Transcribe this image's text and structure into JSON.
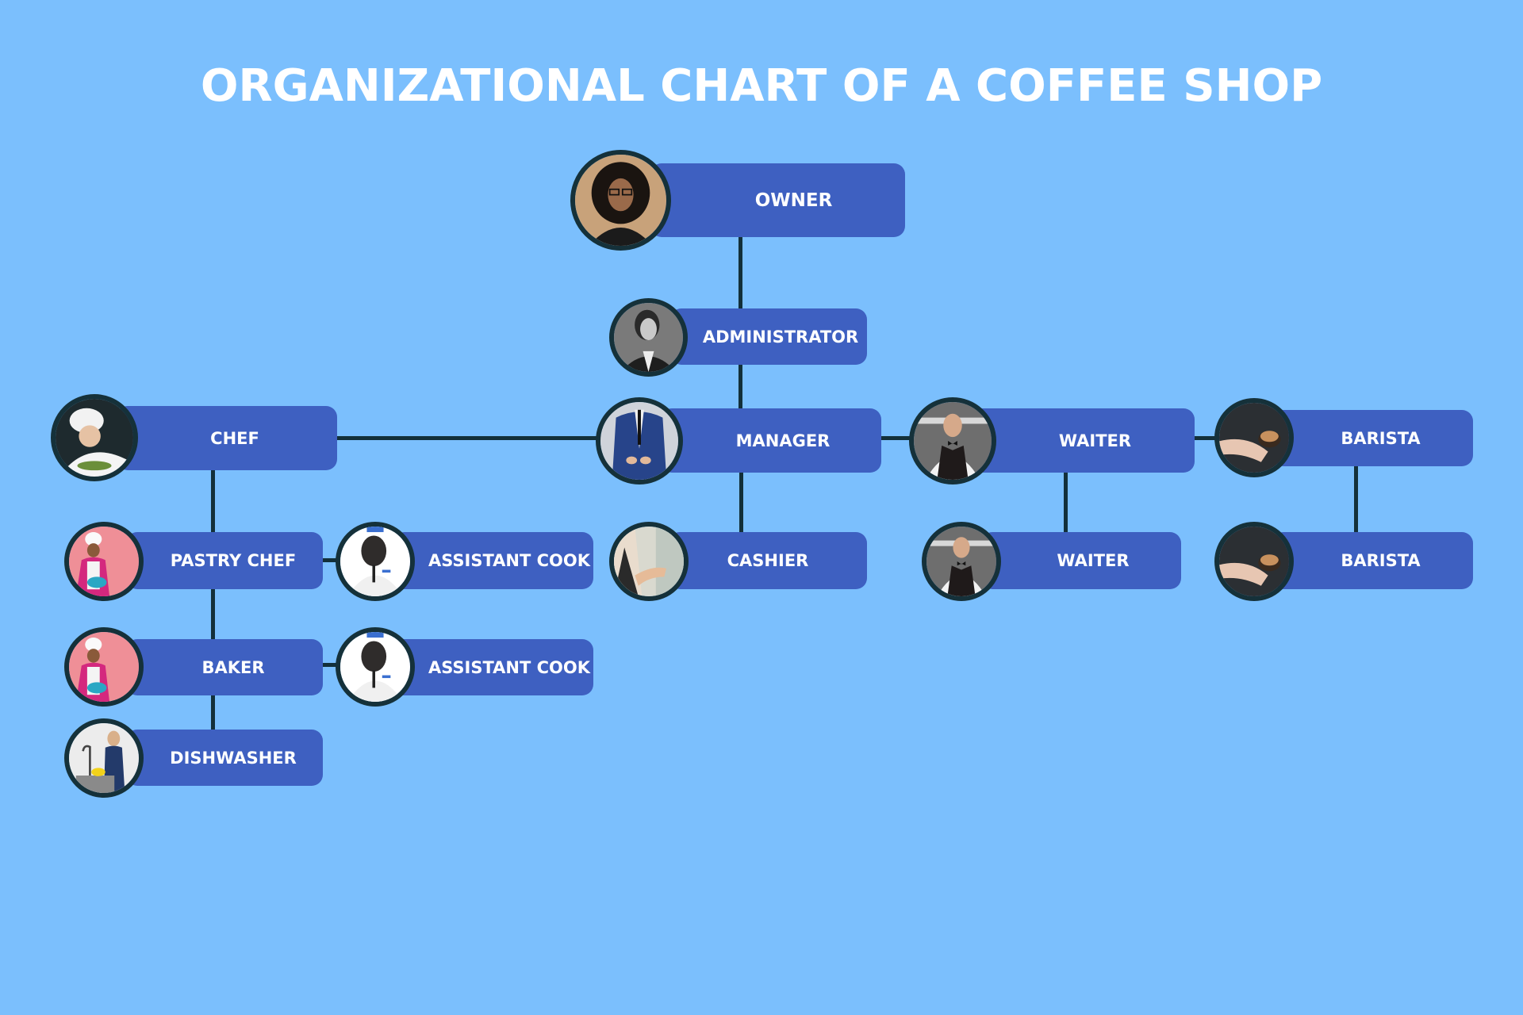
{
  "title": "ORGANIZATIONAL CHART OF A COFFEE SHOP",
  "colors": {
    "background": "#7bbffd",
    "box": "#3e60c1",
    "connector": "#13303a",
    "text": "#ffffff"
  },
  "nodes": {
    "owner": {
      "label": "OWNER",
      "photo": "woman-with-glasses-photo"
    },
    "administrator": {
      "label": "ADMINISTRATOR",
      "photo": "woman-in-suit-photo"
    },
    "manager": {
      "label": "MANAGER",
      "photo": "man-in-blue-suit-photo"
    },
    "chef": {
      "label": "CHEF",
      "photo": "chef-plating-photo"
    },
    "pastry_chef": {
      "label": "PASTRY CHEF",
      "photo": "pastry-chef-photo"
    },
    "assistant_cook_1": {
      "label": "ASSISTANT COOK",
      "photo": "cook-with-pan-photo"
    },
    "baker": {
      "label": "BAKER",
      "photo": "baker-photo"
    },
    "assistant_cook_2": {
      "label": "ASSISTANT COOK",
      "photo": "cook-with-pan-photo"
    },
    "dishwasher": {
      "label": "DISHWASHER",
      "photo": "dishwasher-photo"
    },
    "cashier": {
      "label": "CASHIER",
      "photo": "cashier-photo"
    },
    "waiter_1": {
      "label": "WAITER",
      "photo": "waiter-photo"
    },
    "waiter_2": {
      "label": "WAITER",
      "photo": "waiter-photo"
    },
    "barista_1": {
      "label": "BARISTA",
      "photo": "barista-coffee-cup-photo"
    },
    "barista_2": {
      "label": "BARISTA",
      "photo": "barista-coffee-cup-photo"
    }
  },
  "edges": [
    [
      "owner",
      "administrator"
    ],
    [
      "administrator",
      "manager"
    ],
    [
      "manager",
      "chef"
    ],
    [
      "manager",
      "waiter_1"
    ],
    [
      "waiter_1",
      "barista_1"
    ],
    [
      "manager",
      "cashier"
    ],
    [
      "waiter_1",
      "waiter_2"
    ],
    [
      "barista_1",
      "barista_2"
    ],
    [
      "chef",
      "pastry_chef"
    ],
    [
      "pastry_chef",
      "assistant_cook_1"
    ],
    [
      "pastry_chef",
      "baker"
    ],
    [
      "baker",
      "assistant_cook_2"
    ],
    [
      "baker",
      "dishwasher"
    ]
  ]
}
